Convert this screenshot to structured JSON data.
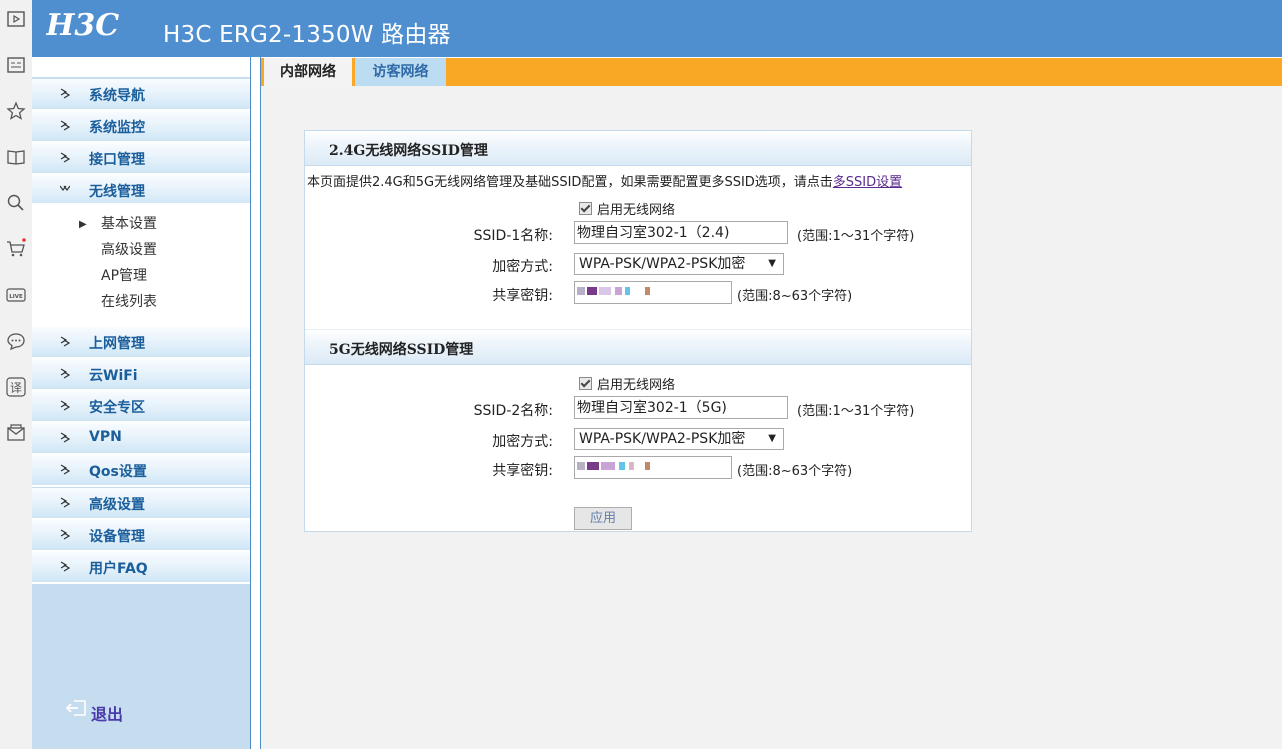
{
  "header": {
    "logo_text": "H3C",
    "title": "H3C ERG2-1350W 路由器"
  },
  "browser_strip_icons": [
    "video-icon",
    "reader-icon",
    "star-icon",
    "book-icon",
    "search-icon",
    "cart-icon",
    "live-icon",
    "chat-icon",
    "translate-icon",
    "mail-icon"
  ],
  "sidebar": {
    "items": [
      {
        "label": "系统导航"
      },
      {
        "label": "系统监控"
      },
      {
        "label": "接口管理"
      },
      {
        "label": "无线管理"
      },
      {
        "label": "上网管理"
      },
      {
        "label": "云WiFi"
      },
      {
        "label": "安全专区"
      },
      {
        "label": "VPN"
      },
      {
        "label": "Qos设置"
      },
      {
        "label": "高级设置"
      },
      {
        "label": "设备管理"
      },
      {
        "label": "用户FAQ"
      }
    ],
    "sub_items": [
      {
        "label": "基本设置"
      },
      {
        "label": "高级设置"
      },
      {
        "label": "AP管理"
      },
      {
        "label": "在线列表"
      }
    ],
    "logout": "退出"
  },
  "tabs": [
    {
      "label": "内部网络"
    },
    {
      "label": "访客网络"
    }
  ],
  "section_24g": {
    "title": "2.4G无线网络SSID管理",
    "description": "本页面提供2.4G和5G无线网络管理及基础SSID配置，如果需要配置更多SSID选项，请点击",
    "link": "多SSID设置",
    "enable_label": "启用无线网络",
    "ssid_label": "SSID-1名称:",
    "ssid_value": "物理自习室302-1（2.4)",
    "ssid_hint": "(范围:1～31个字符)",
    "enc_label": "加密方式:",
    "enc_value": "WPA-PSK/WPA2-PSK加密",
    "key_label": "共享密钥:",
    "key_hint": "(范围:8~63个字符)"
  },
  "section_5g": {
    "title": "5G无线网络SSID管理",
    "enable_label": "启用无线网络",
    "ssid_label": "SSID-2名称:",
    "ssid_value": "物理自习室302-1（5G)",
    "ssid_hint": "(范围:1～31个字符)",
    "enc_label": "加密方式:",
    "enc_value": "WPA-PSK/WPA2-PSK加密",
    "key_label": "共享密钥:",
    "key_hint": "(范围:8~63个字符)"
  },
  "apply_label": "应用",
  "colors": {
    "header": "#4f8fcf",
    "tabbar": "#f9a825",
    "sidebar": "#c6dcef",
    "menu_text": "#1b5e9c"
  }
}
